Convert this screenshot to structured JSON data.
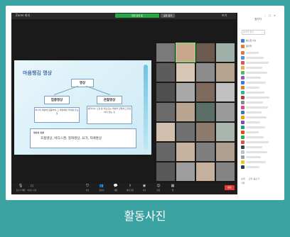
{
  "window": {
    "title": "Zoom 회의",
    "banner": "화면 공유 중",
    "stop_share": "공유 중지",
    "view_label": "보기"
  },
  "slide": {
    "title": "마음챙김 명상",
    "center": "명상",
    "left_title": "집중명상",
    "left_desc": "하나의 대상에 집중하여 그 대상에만 주의를 두는 것",
    "right_title": "관찰명상",
    "right_desc": "생각이나 느낌 등 떠오르는 대상을 관찰하고 판단하지 않는 것",
    "bottom_title": "명상의 종류",
    "bottom_items": "호흡명상, 바디스캔, 정좌명상, 요가, 자애명상"
  },
  "tiles": [
    "#7a7a7a",
    "#c9a78f",
    "#6d5a4f",
    "#9fb0a8",
    "#5c5c5c",
    "#d8c6b5",
    "#8c8c8c",
    "#b5a28f",
    "#4f4f4f",
    "#a9a9a9",
    "#7d6a5d",
    "#c0c0c0",
    "#6b6b6b",
    "#b9a391",
    "#5a6e66",
    "#9a9a9a",
    "#d2bfae",
    "#707070",
    "#8f7b6b",
    "#aab5ae",
    "#666666",
    "#c7b29f",
    "#7f7f7f",
    "#b0a08f",
    "#585858",
    "#9d9d9d",
    "#c4b09c",
    "#848484"
  ],
  "panel": {
    "title": "참가자",
    "search_placeholder": "참가자 찾기",
    "host": "호스트 (나)",
    "self": "참가자",
    "footer_invite": "초대",
    "footer_mute": "모두 음소거",
    "footer_more": "기타"
  },
  "toolbar": {
    "mic": "음소거 해제",
    "video": "비디오 시작",
    "security": "보안",
    "participants": "참가자",
    "chat": "채팅",
    "share": "화면 공유",
    "record": "기록",
    "reactions": "반응",
    "apps": "앱",
    "leave": "종료"
  },
  "caption": "활동사진",
  "colors": {
    "background": "#3aa3a1",
    "share_banner": "#28a745",
    "leave": "#e53935"
  }
}
